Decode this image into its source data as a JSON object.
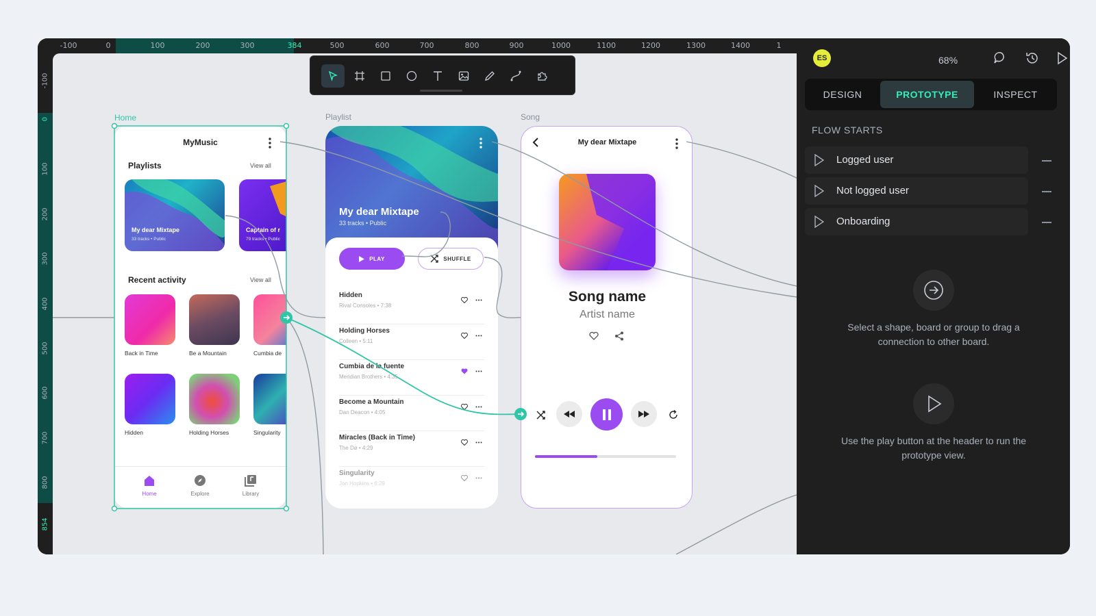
{
  "ruler": {
    "top_ticks": [
      "-100",
      "0",
      "100",
      "200",
      "300",
      "384",
      "500",
      "600",
      "700",
      "800",
      "900",
      "1000",
      "1100",
      "1200",
      "1300",
      "1400",
      "1"
    ],
    "left_ticks": [
      "-100",
      "0",
      "100",
      "200",
      "300",
      "400",
      "500",
      "600",
      "700",
      "800",
      "854"
    ]
  },
  "toolbar": {
    "tools": [
      "move-tool",
      "board-tool",
      "rectangle-tool",
      "ellipse-tool",
      "text-tool",
      "image-tool",
      "pencil-tool",
      "path-tool",
      "plugins-tool"
    ]
  },
  "boards": {
    "home": {
      "label": "Home",
      "title": "MyMusic",
      "playlists_heading": "Playlists",
      "view_all": "View all",
      "playlist1_title": "My dear Mixtape",
      "playlist1_sub": "33 tracks • Public",
      "playlist2_title": "Captain of r",
      "playlist2_sub": "79 tracks • Public",
      "recent_heading": "Recent activity",
      "recent_view_all": "View all",
      "recent": [
        "Back in Time",
        "Be a Mountain",
        "Cumbia de",
        "Hidden",
        "Holding Horses",
        "Singularity"
      ],
      "nav": [
        "Home",
        "Explore",
        "Library"
      ]
    },
    "playlist": {
      "label": "Playlist",
      "title": "My dear Mixtape",
      "sub": "33 tracks • Public",
      "play": "PLAY",
      "shuffle": "SHUFFLE",
      "tracks": [
        {
          "name": "Hidden",
          "meta": "Rival Consoles • 7:38"
        },
        {
          "name": "Holding Horses",
          "meta": "Colleen • 5:11"
        },
        {
          "name": "Cumbia de la fuente",
          "meta": "Meridian Brothers • 4:35"
        },
        {
          "name": "Become a Mountain",
          "meta": "Dan Deacon • 4:05"
        },
        {
          "name": "Miracles (Back in Time)",
          "meta": "The Dø • 4:29"
        },
        {
          "name": "Singularity",
          "meta": "Jon Hopkins • 6:29"
        }
      ]
    },
    "song": {
      "label": "Song",
      "title": "My dear Mixtape",
      "song_name": "Song name",
      "artist": "Artist name",
      "progress": 0.44
    }
  },
  "sidebar": {
    "avatar": "ES",
    "zoom": "68%",
    "tabs": [
      "DESIGN",
      "PROTOTYPE",
      "INSPECT"
    ],
    "active_tab": "PROTOTYPE",
    "section_title": "FLOW STARTS",
    "flows": [
      "Logged user",
      "Not logged user",
      "Onboarding"
    ],
    "help1": "Select a shape, board or group to drag a connection to other board.",
    "help2": "Use the play button at the header to run the prototype view."
  },
  "colors": {
    "accent": "#31efb8",
    "selection": "#31c5a8",
    "purple": "#9a4cf0",
    "dark": "#1f1f1f"
  }
}
